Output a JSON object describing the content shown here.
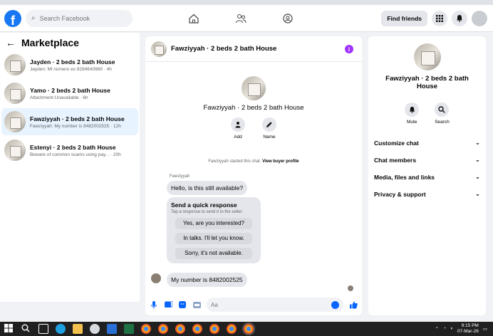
{
  "header": {
    "search_placeholder": "Search Facebook",
    "find_friends_label": "Find friends"
  },
  "sidebar": {
    "title": "Marketplace",
    "conversations": [
      {
        "name": "Jayden · 2 beds 2 bath House",
        "preview": "Jayden: Mi número es 9294640969 · 4h"
      },
      {
        "name": "Yamo · 2 beds 2 bath House",
        "preview": "Attachment Unavailable · 6h"
      },
      {
        "name": "Fawziyyah · 2 beds 2 bath House",
        "preview": "Fawziyyah: My number is 8482002525 · 12h"
      },
      {
        "name": "Estenyi · 2 beds 2 bath House",
        "preview": "Beware of common scams using pay... · 20h"
      }
    ]
  },
  "chat": {
    "title": "Fawziyyah · 2 beds 2 bath House",
    "profile_name": "Fawziyyah · 2 beds 2 bath House",
    "actions": {
      "add": "Add",
      "name": "Name"
    },
    "started_text": "Fawziyyah started this chat.",
    "view_buyer_profile": "View buyer profile",
    "sender_label": "Fawziyyah",
    "first_message": "Hello, is this still available?",
    "quick_response": {
      "title": "Send a quick response",
      "subtitle": "Tap a response to send it to the seller.",
      "options": [
        "Yes, are you interested?",
        "In talks. I'll let you know.",
        "Sorry, it's not available."
      ]
    },
    "last_message": "My number is 8482002525",
    "composer_placeholder": "Aa"
  },
  "details": {
    "name": "Fawziyyah · 2 beds 2 bath House",
    "mute": "Mute",
    "search": "Search",
    "menu": [
      "Customize chat",
      "Chat members",
      "Media, files and links",
      "Privacy & support"
    ]
  },
  "taskbar": {
    "time": "9:15 PM",
    "date": "07-Mar-26"
  },
  "colors": {
    "brand": "#1877f2",
    "accent": "#0866ff",
    "active_conversation": "#e7f3ff"
  }
}
